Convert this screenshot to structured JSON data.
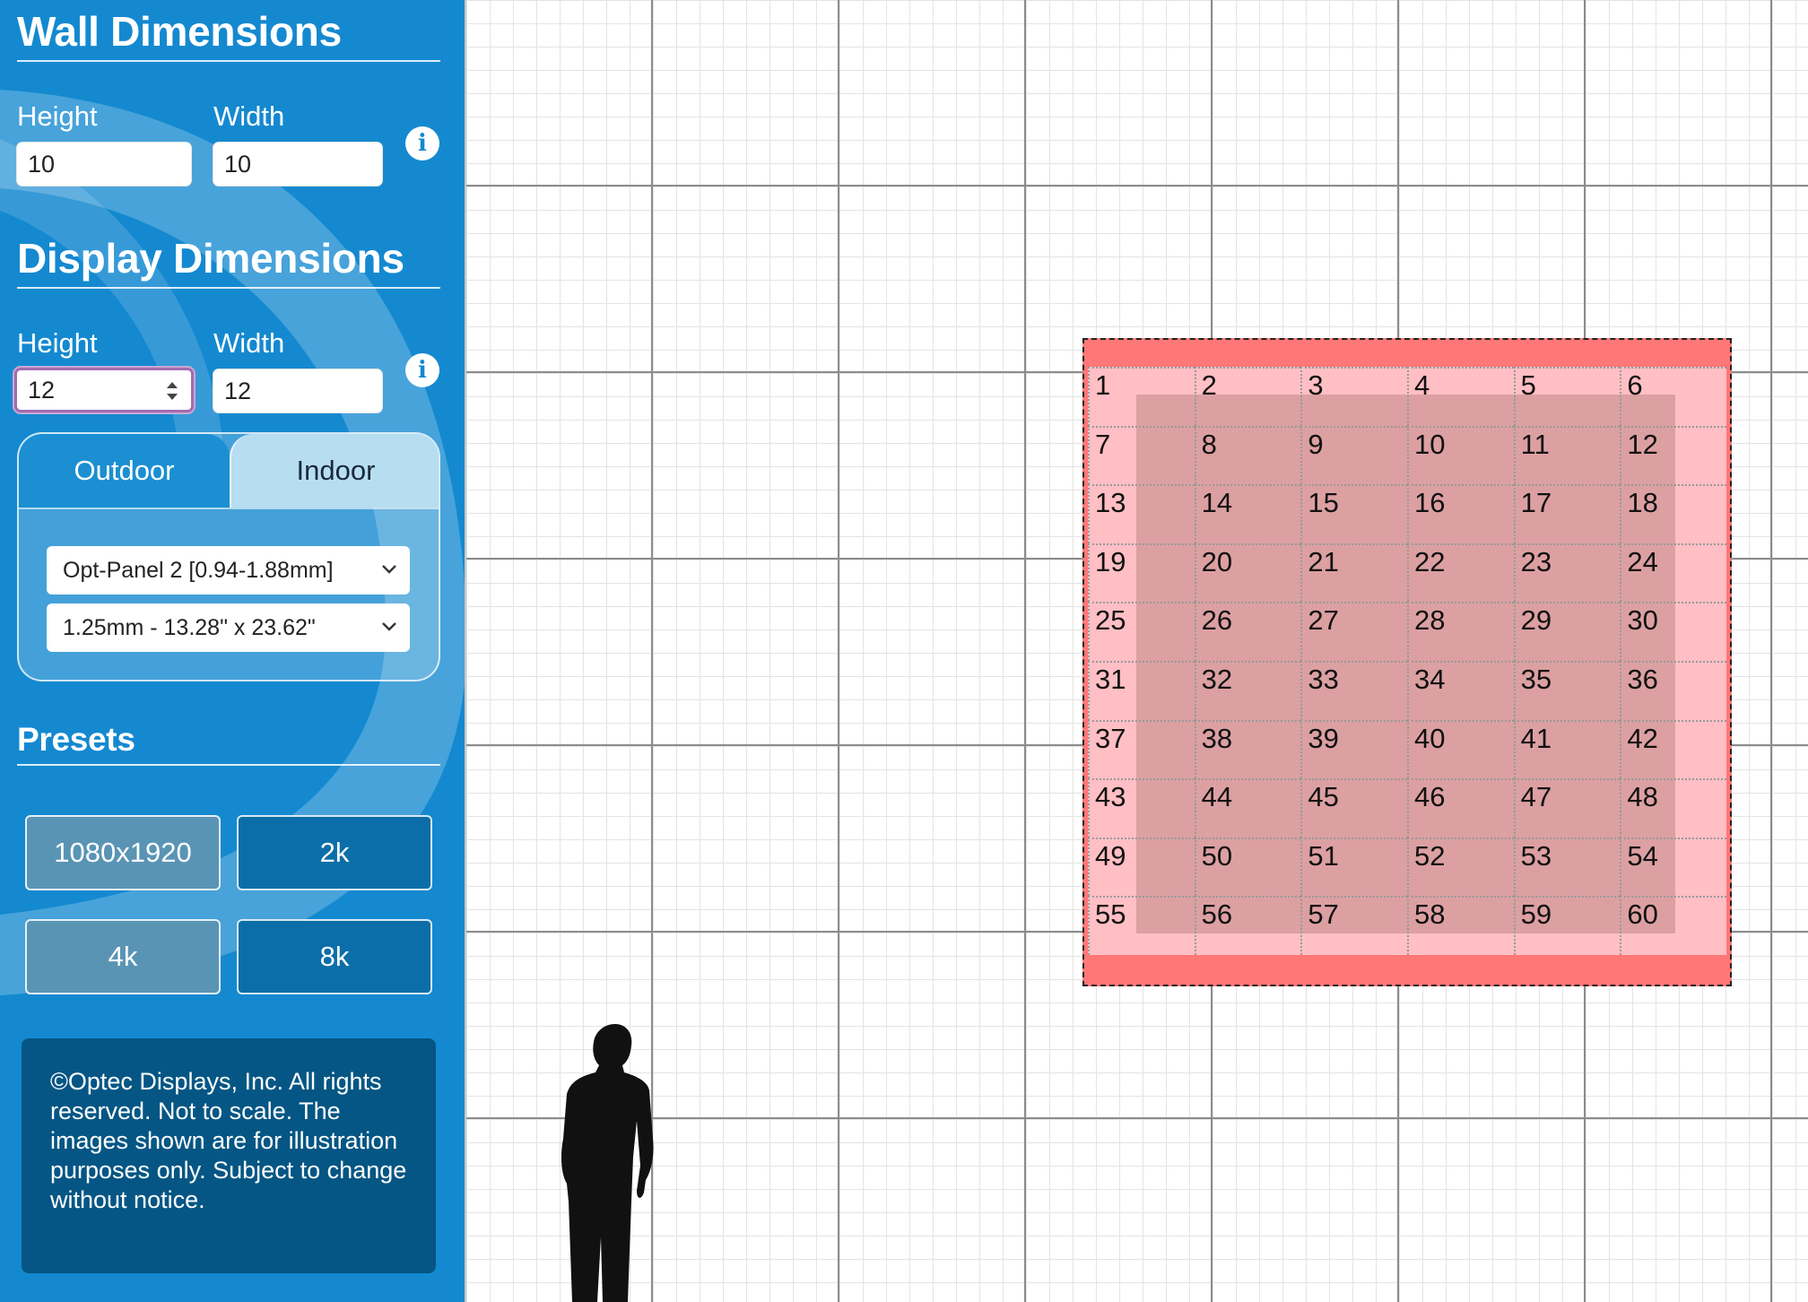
{
  "wall": {
    "title": "Wall Dimensions",
    "height_label": "Height",
    "width_label": "Width",
    "height_value": "10",
    "width_value": "10"
  },
  "display": {
    "title": "Display Dimensions",
    "height_label": "Height",
    "width_label": "Width",
    "height_value": "12",
    "width_value": "12"
  },
  "info_glyph": "i",
  "tabs": [
    {
      "label": "Outdoor",
      "active": false
    },
    {
      "label": "Indoor",
      "active": true
    }
  ],
  "selects": {
    "panel": "Opt-Panel 2 [0.94-1.88mm]",
    "pitch": "1.25mm - 13.28\" x 23.62\""
  },
  "presets": {
    "title": "Presets",
    "buttons": [
      "1080x1920",
      "2k",
      "4k",
      "8k"
    ]
  },
  "copyright": "©Optec Displays, Inc. All rights reserved. Not to scale. The images shown are for illustration purposes only. Subject to change without notice.",
  "panel_grid": {
    "columns": 6,
    "rows": 10,
    "labels": [
      "1",
      "2",
      "3",
      "4",
      "5",
      "6",
      "7",
      "8",
      "9",
      "10",
      "11",
      "12",
      "13",
      "14",
      "15",
      "16",
      "17",
      "18",
      "19",
      "20",
      "21",
      "22",
      "23",
      "24",
      "25",
      "26",
      "27",
      "28",
      "29",
      "30",
      "31",
      "32",
      "33",
      "34",
      "35",
      "36",
      "37",
      "38",
      "39",
      "40",
      "41",
      "42",
      "43",
      "44",
      "45",
      "46",
      "47",
      "48",
      "49",
      "50",
      "51",
      "52",
      "53",
      "54",
      "55",
      "56",
      "57",
      "58",
      "59",
      "60"
    ]
  },
  "colors": {
    "sidebar": "#1489d0",
    "wall_fill": "#ff7777",
    "panel_fill": "#ffbfc4",
    "display_area": "#dca0a2",
    "copyright_box": "#055684"
  },
  "icons": {
    "info": "info-icon",
    "chevron": "chevron-down-icon",
    "spinner": "stepper-icon",
    "person": "person-silhouette-icon"
  }
}
